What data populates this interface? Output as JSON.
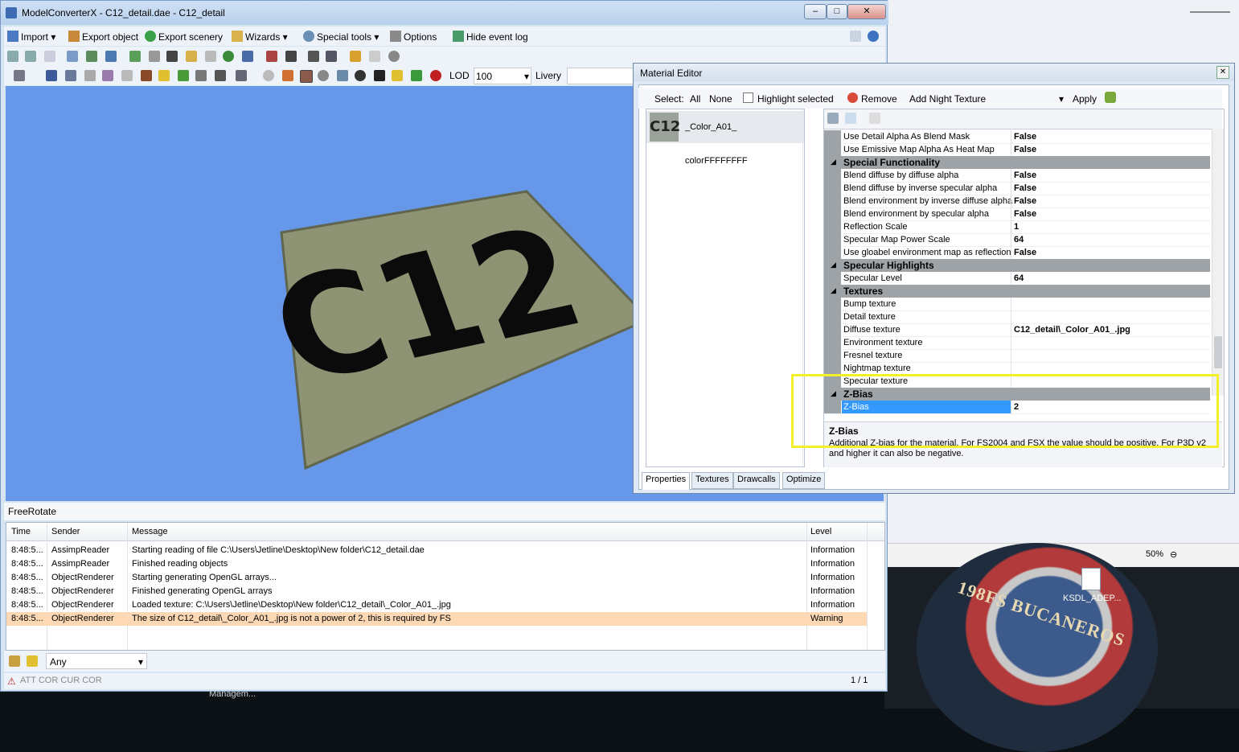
{
  "window": {
    "title": "ModelConverterX - C12_detail.dae - C12_detail",
    "minimize": "‒",
    "maximize": "□",
    "close": "✕"
  },
  "menubar": {
    "import": "Import",
    "export_object": "Export object",
    "export_scenery": "Export scenery",
    "wizards": "Wizards",
    "special_tools": "Special tools",
    "options": "Options",
    "hide_event_log": "Hide event log"
  },
  "toolbar3": {
    "lod_label": "LOD",
    "lod_value": "100",
    "livery_label": "Livery"
  },
  "viewport": {
    "plate_text": "C12"
  },
  "freerotate": "FreeRotate",
  "log": {
    "columns": [
      "Time",
      "Sender",
      "Message",
      "Level"
    ],
    "rows": [
      {
        "time": "8:48:5...",
        "sender": "AssimpReader",
        "message": "Starting reading of file C:\\Users\\Jetline\\Desktop\\New folder\\C12_detail.dae",
        "level": "Information"
      },
      {
        "time": "8:48:5...",
        "sender": "AssimpReader",
        "message": "Finished reading objects",
        "level": "Information"
      },
      {
        "time": "8:48:5...",
        "sender": "ObjectRenderer",
        "message": "Starting generating OpenGL arrays...",
        "level": "Information"
      },
      {
        "time": "8:48:5...",
        "sender": "ObjectRenderer",
        "message": "Finished generating OpenGL arrays",
        "level": "Information"
      },
      {
        "time": "8:48:5...",
        "sender": "ObjectRenderer",
        "message": "Loaded texture: C:\\Users\\Jetline\\Desktop\\New folder\\C12_detail\\_Color_A01_.jpg",
        "level": "Information"
      },
      {
        "time": "8:48:5...",
        "sender": "ObjectRenderer",
        "message": "The size of C12_detail\\_Color_A01_.jpg is not a power of 2, this is required by FS",
        "level": "Warning"
      }
    ]
  },
  "filter": {
    "value": "Any"
  },
  "status": {
    "left": "ATT COR  CUR COR",
    "right": "1 / 1"
  },
  "taskbar": "Managem...",
  "desktop": {
    "zoom": "50%",
    "icon_label": "KSDL_ADEP...",
    "patch_text": "198FS   BUCANEROS"
  },
  "material_editor": {
    "title": "Material Editor",
    "close": "✕",
    "toolbar": {
      "select_label": "Select:",
      "all": "All",
      "none": "None",
      "highlight_selected": "Highlight selected",
      "remove": "Remove",
      "add_night_texture": "Add Night Texture",
      "apply": "Apply"
    },
    "materials": [
      {
        "thumb": "C12",
        "name": "_Color_A01_"
      },
      {
        "thumb": "",
        "name": "colorFFFFFFFF"
      }
    ],
    "properties": [
      {
        "kind": "row",
        "name": "Use Detail Alpha As Blend Mask",
        "value": "False"
      },
      {
        "kind": "row",
        "name": "Use Emissive Map Alpha As Heat Map",
        "value": "False"
      },
      {
        "kind": "cat",
        "name": "Special Functionality"
      },
      {
        "kind": "row",
        "name": "Blend diffuse by diffuse alpha",
        "value": "False"
      },
      {
        "kind": "row",
        "name": "Blend diffuse by inverse specular alpha",
        "value": "False"
      },
      {
        "kind": "row",
        "name": "Blend environment by inverse diffuse alpha",
        "value": "False"
      },
      {
        "kind": "row",
        "name": "Blend environment by specular alpha",
        "value": "False"
      },
      {
        "kind": "row",
        "name": "Reflection Scale",
        "value": "1"
      },
      {
        "kind": "row",
        "name": "Specular Map Power Scale",
        "value": "64"
      },
      {
        "kind": "row",
        "name": "Use gloabel environment map as reflection",
        "value": "False"
      },
      {
        "kind": "cat",
        "name": "Specular Highlights"
      },
      {
        "kind": "row",
        "name": "Specular Level",
        "value": "64"
      },
      {
        "kind": "cat",
        "name": "Textures"
      },
      {
        "kind": "row",
        "name": "Bump texture",
        "value": ""
      },
      {
        "kind": "row",
        "name": "Detail texture",
        "value": ""
      },
      {
        "kind": "row",
        "name": "Diffuse texture",
        "value": "C12_detail\\_Color_A01_.jpg"
      },
      {
        "kind": "row",
        "name": "Environment texture",
        "value": ""
      },
      {
        "kind": "row",
        "name": "Fresnel texture",
        "value": ""
      },
      {
        "kind": "row",
        "name": "Nightmap texture",
        "value": ""
      },
      {
        "kind": "row",
        "name": "Specular texture",
        "value": ""
      },
      {
        "kind": "cat",
        "name": "Z-Bias"
      },
      {
        "kind": "row",
        "name": "Z-Bias",
        "value": "2",
        "selected": true
      }
    ],
    "help": {
      "title": "Z-Bias",
      "text": "Additional Z-bias for the material. For FS2004 and FSX the value should be positive. For P3D v2 and higher it can also be negative."
    },
    "tabs": [
      "Properties",
      "Textures",
      "Drawcalls",
      "Optimize"
    ]
  },
  "colors": {
    "viewport_bg": "#6797e8",
    "plate": "#8e9373",
    "warning_row": "#fdd8b4",
    "selection": "#3399ff",
    "annotation": "#f3ef2a"
  }
}
